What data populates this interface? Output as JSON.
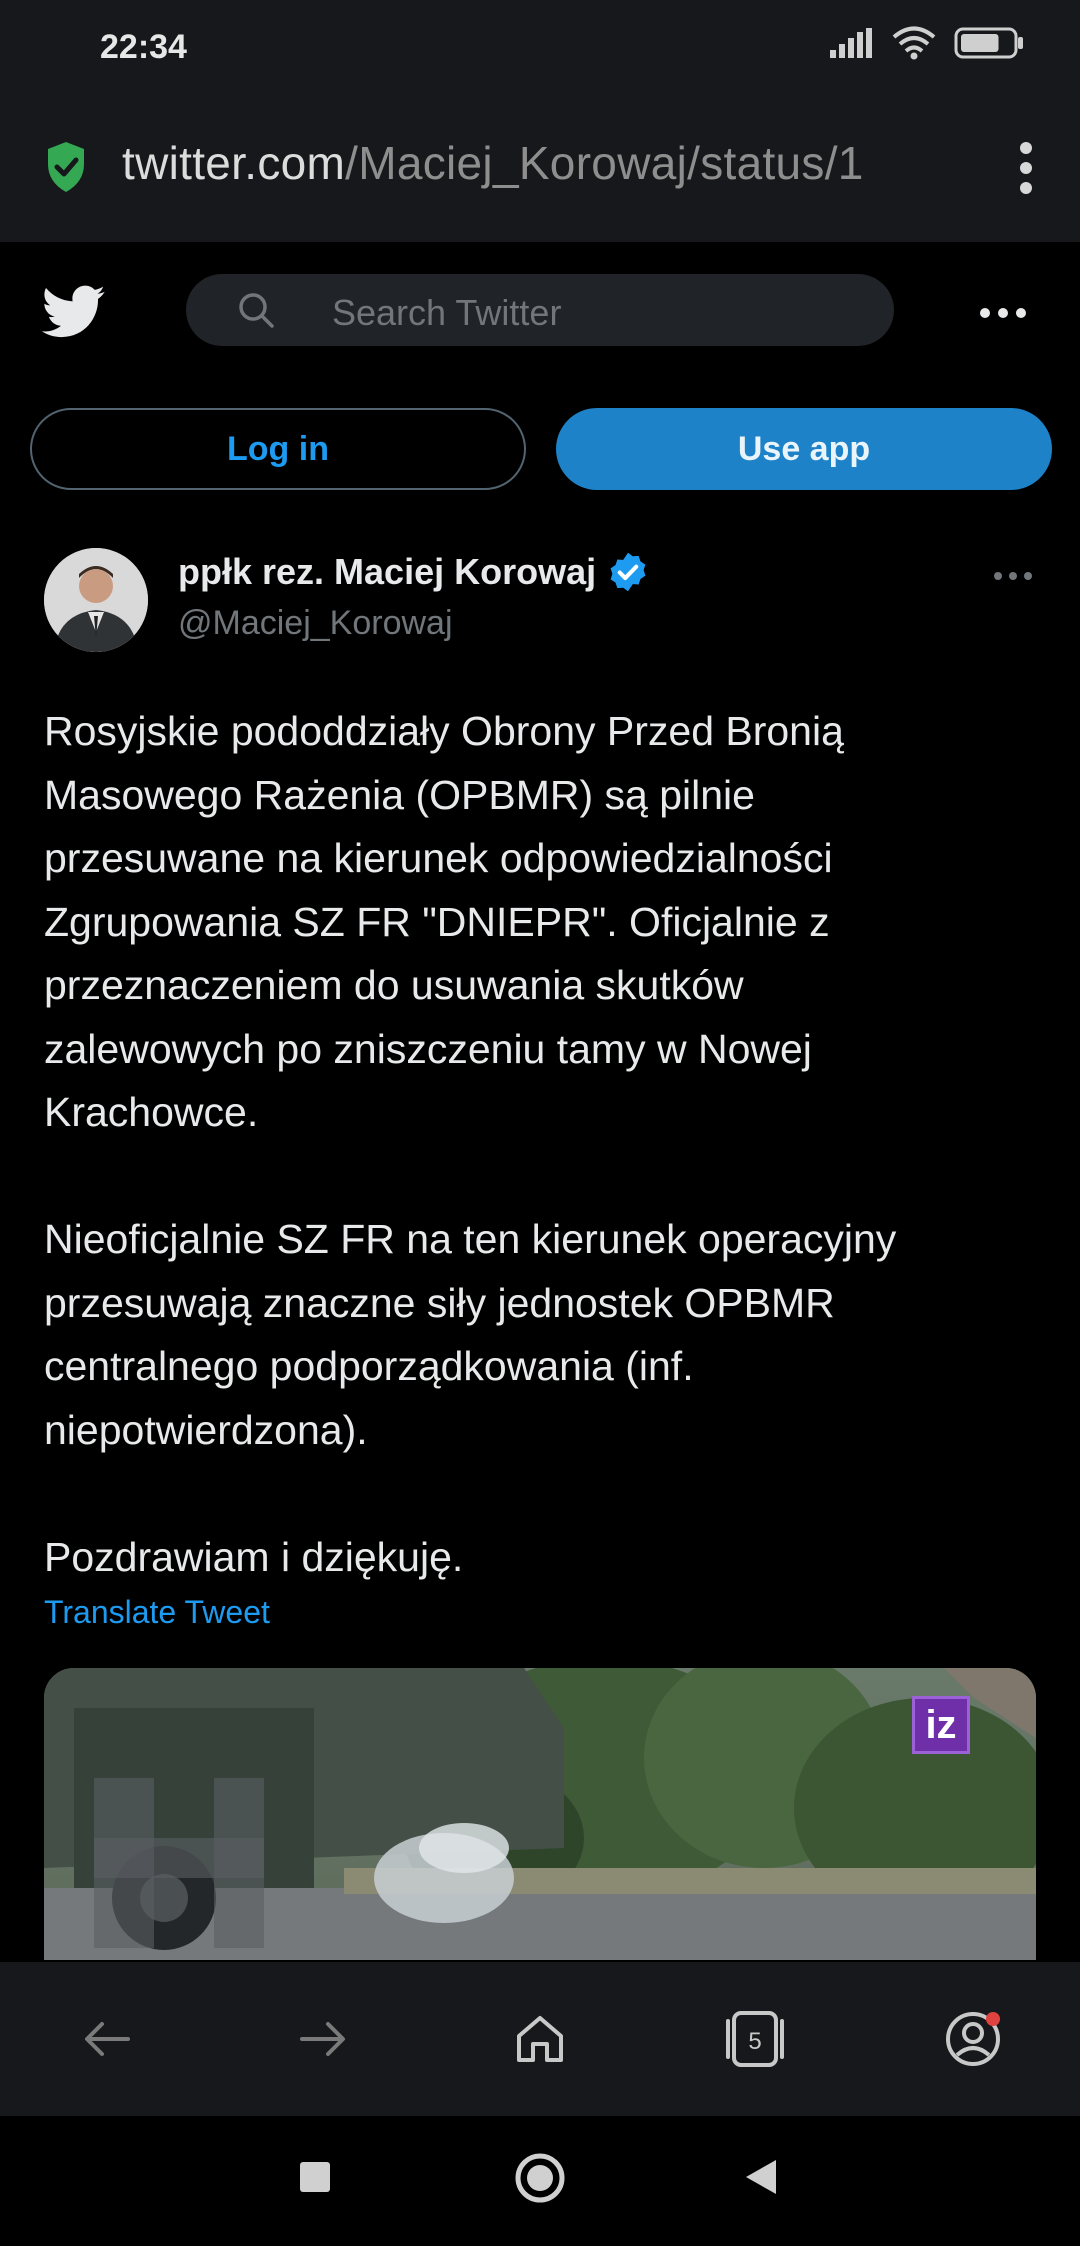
{
  "status_bar": {
    "time": "22:34",
    "battery_level": 0.75
  },
  "browser": {
    "url_domain": "twitter.com",
    "url_path": "/Maciej_Korowaj/status/1",
    "secure_icon": "shield-check-icon",
    "tab_count": "5"
  },
  "twitter_header": {
    "logo": "twitter-bird-icon",
    "search_placeholder": "Search Twitter"
  },
  "actions": {
    "login_label": "Log in",
    "use_app_label": "Use app"
  },
  "tweet": {
    "author_name": "ppłk rez. Maciej Korowaj",
    "author_handle": "@Maciej_Korowaj",
    "verified": true,
    "text": "Rosyjskie pododdziały Obrony Przed Bronią\nMasowego Rażenia (OPBMR) są pilnie\nprzesuwane na kierunek odpowiedzialności\nZgrupowania SZ FR \"DNIEPR\". Oficjalnie z\nprzeznaczeniem do usuwania skutków\nzalewowych po zniszczeniu tamy w Nowej\nKrachowce.\n\nNieoficjalnie SZ FR na ten kierunek operacyjny\nprzesuwają znaczne siły jednostek OPBMR\ncentralnego podporządkowania (inf.\nniepotwierdzona).\n\nPozdrawiam i dziękuję.",
    "translate_label": "Translate Tweet",
    "media_badge": "iz"
  },
  "colors": {
    "twitter_blue": "#1d9bf0",
    "use_app_bg": "#1d82c8",
    "chrome_bg": "#17181b",
    "secure_green": "#34a853"
  }
}
